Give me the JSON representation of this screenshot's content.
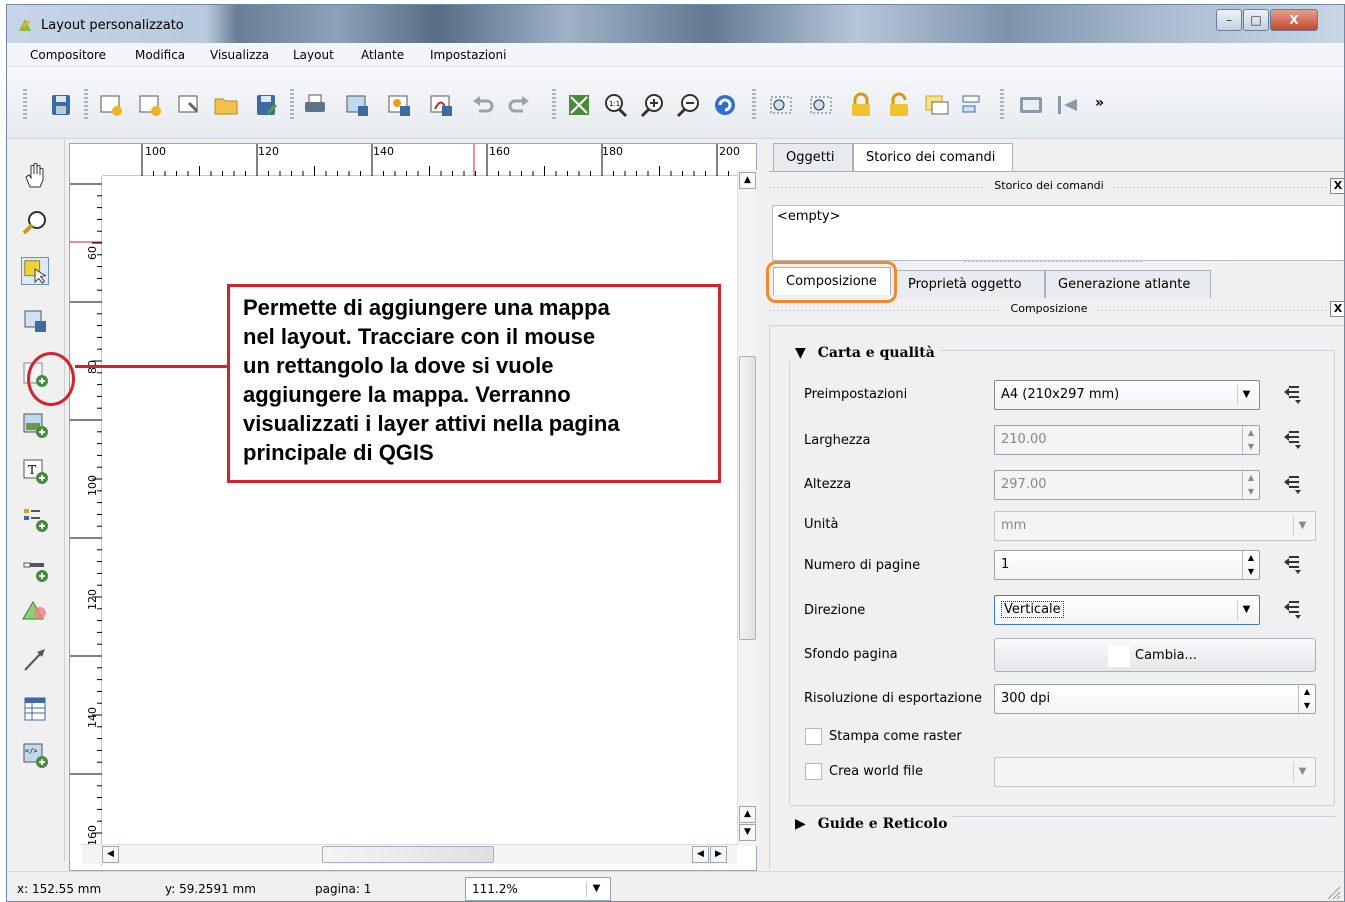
{
  "window": {
    "title": "Layout personalizzato",
    "minimize": "–",
    "maximize": "□",
    "close": "X"
  },
  "menubar": [
    "Compositore",
    "Modifica",
    "Visualizza",
    "Layout",
    "Atlante",
    "Impostazioni"
  ],
  "toolbar": {
    "overflow": "»",
    "icons": [
      "save-icon",
      "new-layout-icon",
      "duplicate-layout-icon",
      "layout-manager-icon",
      "open-template-icon",
      "save-template-icon",
      "print-icon",
      "export-image-icon",
      "export-svg-icon",
      "export-pdf-icon",
      "undo-icon",
      "redo-icon",
      "zoom-full-icon",
      "zoom-actual-icon",
      "zoom-in-icon",
      "zoom-out-icon",
      "refresh-icon",
      "group-icon",
      "ungroup-icon",
      "lock-icon",
      "unlock-icon",
      "raise-icon",
      "align-icon",
      "atlas-preview-icon",
      "first-feature-icon"
    ]
  },
  "left_tools": [
    "pan-icon",
    "zoom-tool-icon",
    "select-move-icon",
    "move-content-icon",
    "add-map-icon",
    "add-image-icon",
    "add-label-icon",
    "add-legend-icon",
    "add-scalebar-icon",
    "add-shape-icon",
    "add-arrow-icon",
    "add-table-icon",
    "add-html-icon"
  ],
  "ruler": {
    "h_labels": [
      "100",
      "120",
      "140",
      "160",
      "180",
      "200"
    ],
    "v_labels": [
      "60",
      "80",
      "100",
      "120",
      "140",
      "160"
    ]
  },
  "callout": {
    "text": "Permette  di aggiungere una mappa\nnel layout. Tracciare con il mouse\nun rettangolo la dove si vuole\naggiungere la mappa. Verranno\nvisualizzati i layer attivi nella pagina\nprincipale di QGIS"
  },
  "panel": {
    "tabs_top": [
      "Oggetti",
      "Storico dei comandi"
    ],
    "history_title": "Storico dei comandi",
    "history_items": [
      "<empty>"
    ],
    "tabs_bottom": [
      "Composizione",
      "Proprietà oggetto",
      "Generazione atlante"
    ],
    "composition_title": "Composizione",
    "close_glyph": "X",
    "paper_group": "Carta e qualità",
    "fields": {
      "preset_label": "Preimpostazioni",
      "preset_value": "A4 (210x297 mm)",
      "width_label": "Larghezza",
      "width_value": "210.00",
      "height_label": "Altezza",
      "height_value": "297.00",
      "unit_label": "Unità",
      "unit_value": "mm",
      "pages_label": "Numero di pagine",
      "pages_value": "1",
      "orientation_label": "Direzione",
      "orientation_value": "Verticale",
      "background_label": "Sfondo pagina",
      "background_button": "Cambia...",
      "resolution_label": "Risoluzione di esportazione",
      "resolution_value": "300 dpi",
      "raster_label": "Stampa come raster",
      "world_label": "Crea world file",
      "world_value": ""
    },
    "guides_group": "Guide e Reticolo"
  },
  "statusbar": {
    "x": "x: 152.55 mm",
    "y": "y: 59.2591 mm",
    "page": "pagina: 1",
    "zoom": "111.2%"
  },
  "colors": {
    "callout_red": "#d5232c",
    "tab_highlight": "#f08a2a"
  }
}
